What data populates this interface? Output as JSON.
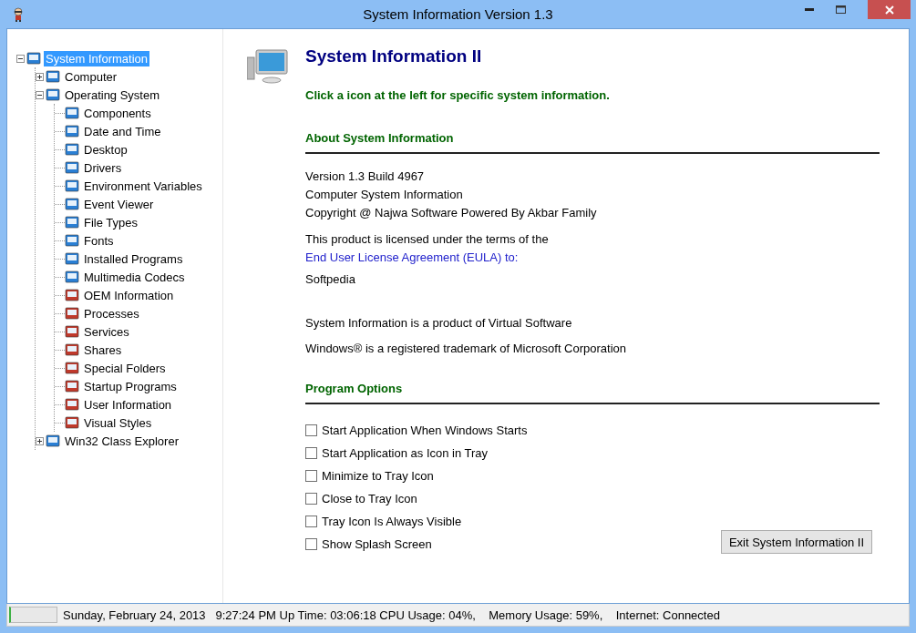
{
  "window": {
    "title": "System Information Version 1.3"
  },
  "tree": [
    {
      "label": "System Information",
      "selected": true,
      "expanded": true,
      "children": [
        {
          "label": "Computer",
          "selected": false,
          "expanded": false
        },
        {
          "label": "Operating System",
          "selected": false,
          "expanded": true,
          "children": [
            {
              "label": "Components",
              "selected": false
            },
            {
              "label": "Date and Time",
              "selected": false
            },
            {
              "label": "Desktop",
              "selected": false
            },
            {
              "label": "Drivers",
              "selected": false
            },
            {
              "label": "Environment Variables",
              "selected": false
            },
            {
              "label": "Event Viewer",
              "selected": false
            },
            {
              "label": "File Types",
              "selected": false
            },
            {
              "label": "Fonts",
              "selected": false
            },
            {
              "label": "Installed Programs",
              "selected": false
            },
            {
              "label": "Multimedia Codecs",
              "selected": false
            },
            {
              "label": "OEM Information",
              "selected": false
            },
            {
              "label": "Processes",
              "selected": false
            },
            {
              "label": "Services",
              "selected": false
            },
            {
              "label": "Shares",
              "selected": false
            },
            {
              "label": "Special Folders",
              "selected": false
            },
            {
              "label": "Startup Programs",
              "selected": false
            },
            {
              "label": "User Information",
              "selected": false
            },
            {
              "label": "Visual Styles",
              "selected": false
            }
          ]
        },
        {
          "label": "Win32 Class Explorer",
          "selected": false,
          "expanded": false
        }
      ]
    }
  ],
  "main": {
    "heading": "System Information II",
    "hint": "Click a icon at the left for specific system information.",
    "about": {
      "title": "About System Information",
      "lines": [
        "Version 1.3 Build 4967",
        "Computer System Information",
        "Copyright @ Najwa Software Powered By Akbar Family"
      ],
      "license_text": "This product is licensed under the terms of the",
      "license_link": "End User License Agreement (EULA) to:",
      "licensee": "Softpedia",
      "notes": [
        "System Information is a product of Virtual Software",
        "Windows® is a registered trademark of Microsoft Corporation"
      ]
    },
    "options": {
      "title": "Program Options",
      "items": [
        {
          "label": "Start Application When Windows Starts",
          "checked": false
        },
        {
          "label": "Start Application as Icon in Tray",
          "checked": false
        },
        {
          "label": "Minimize to Tray Icon",
          "checked": false
        },
        {
          "label": "Close to Tray Icon",
          "checked": false
        },
        {
          "label": "Tray Icon Is Always Visible",
          "checked": false
        },
        {
          "label": "Show Splash Screen",
          "checked": false
        }
      ]
    },
    "exit_button": "Exit System Information II"
  },
  "status_bar": {
    "text": "Sunday, February 24, 2013   9:27:24 PM Up Time: 03:06:18 CPU Usage: 04%,    Memory Usage: 59%,    Internet: Connected"
  }
}
